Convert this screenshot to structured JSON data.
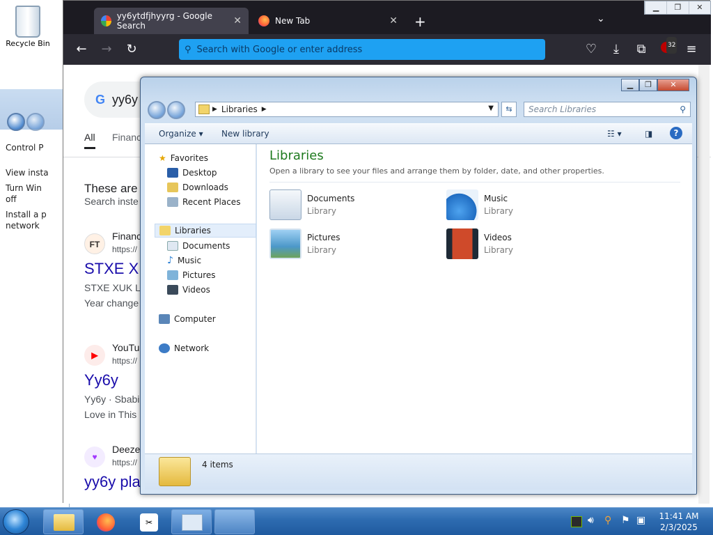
{
  "desktop": {
    "recycle_bin_label": "Recycle Bin"
  },
  "control_panel": {
    "links": [
      "Control P",
      "View insta",
      "Turn Win\noff",
      "Install a p\nnetwork"
    ]
  },
  "browser": {
    "tabs": [
      {
        "label": "yy6ytdfjhyyrg - Google Search",
        "icon": "google-icon",
        "active": true
      },
      {
        "label": "New Tab",
        "icon": "firefox-icon",
        "active": false
      }
    ],
    "url_placeholder": "Search with Google or enter address",
    "extension_badge": "32",
    "search_query": "yy6y",
    "search_tabs": [
      "All",
      "Financ"
    ],
    "heading": "These are",
    "subheading": "Search inste",
    "results": [
      {
        "site": "Financ",
        "url": "https://",
        "title": "STXE X",
        "snippet1": "STXE XUK LI",
        "snippet2": "Year change",
        "icon_text": "FT"
      },
      {
        "site": "YouTu",
        "url": "https://",
        "title": "Yy6y",
        "snippet1": "Yy6y · Sbabi",
        "snippet2": "Love in This",
        "icon_text": "▶"
      },
      {
        "site": "Deeze",
        "url": "https://",
        "title": "yy6y pla",
        "icon_text": "♥"
      }
    ]
  },
  "explorer": {
    "breadcrumb": "Libraries",
    "search_placeholder": "Search Libraries",
    "toolbar": {
      "organize": "Organize",
      "new_library": "New library"
    },
    "nav": {
      "favorites": "Favorites",
      "desktop": "Desktop",
      "downloads": "Downloads",
      "recent": "Recent Places",
      "libraries": "Libraries",
      "documents": "Documents",
      "music": "Music",
      "pictures": "Pictures",
      "videos": "Videos",
      "computer": "Computer",
      "network": "Network"
    },
    "heading": "Libraries",
    "description": "Open a library to see your files and arrange them by folder, date, and other properties.",
    "libraries": [
      {
        "name": "Documents",
        "type": "Library"
      },
      {
        "name": "Music",
        "type": "Library"
      },
      {
        "name": "Pictures",
        "type": "Library"
      },
      {
        "name": "Videos",
        "type": "Library"
      }
    ],
    "item_count": "4 items"
  },
  "taskbar": {
    "time": "11:41 AM",
    "date": "2/3/2025"
  }
}
